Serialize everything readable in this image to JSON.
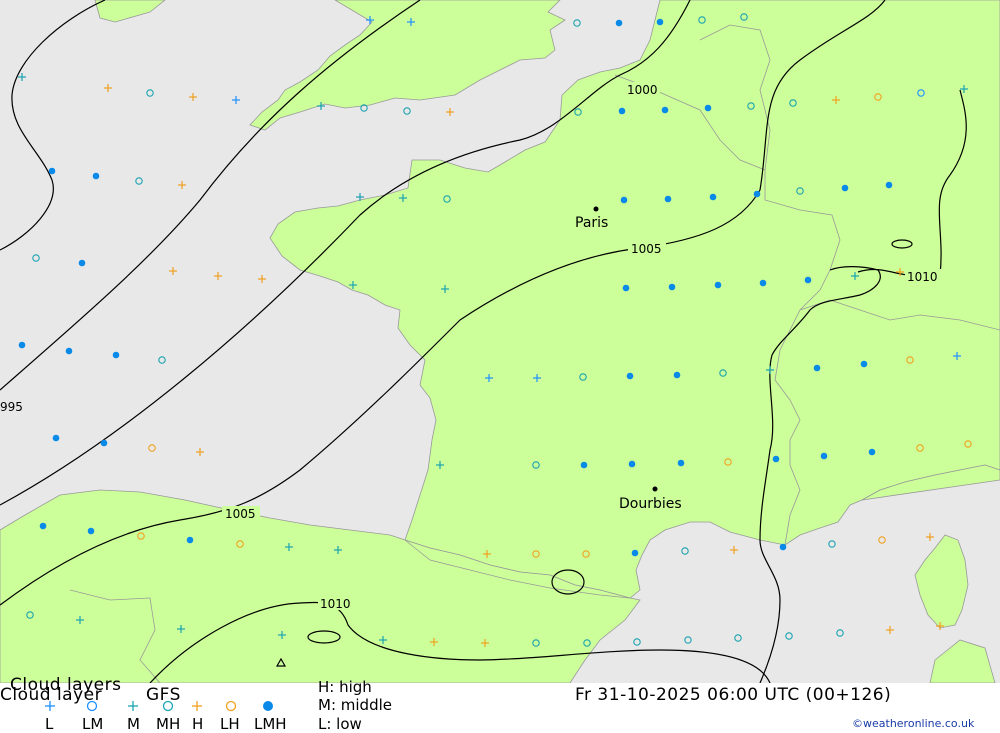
{
  "map": {
    "colors": {
      "sea": "#e8e8e8",
      "land": "#ccff99",
      "border": "#999999",
      "isobar": "#000000",
      "high": "#1aa3b0",
      "middle": "#f0a020",
      "low": "#1e90ff",
      "low_dot": "#0a8ae8"
    },
    "cities": [
      {
        "name": "Paris"
      },
      {
        "name": "Dourbies"
      }
    ],
    "isobar_labels": [
      "1000",
      "1005",
      "1005",
      "1010",
      "1010",
      "995"
    ],
    "symbols_legend": {
      "high_plus": "teal plus = H (high)",
      "mid_plus": "orange plus",
      "ring": "open circle",
      "dot": "filled dot"
    }
  },
  "footer": {
    "title_line1": "Cloud layers",
    "title_line2": "Cloud layer",
    "model": "GFS",
    "legend_labels": [
      "L",
      "LM",
      "M",
      "MH",
      "H",
      "LH",
      "LMH"
    ],
    "key_high": "H: high",
    "key_middle": "M: middle",
    "key_low": "L: low",
    "datetime": "Fr 31-10-2025 06:00 UTC (00+126)",
    "credit": "©weatheronline.co.uk"
  }
}
